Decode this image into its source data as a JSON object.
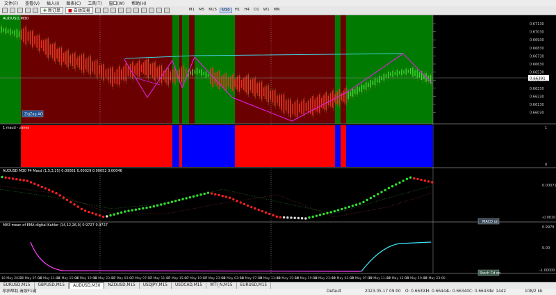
{
  "menu": [
    "文件(F)",
    "查看(V)",
    "插入(I)",
    "图表(C)",
    "工具(T)",
    "窗口(W)",
    "帮助(H)"
  ],
  "toolbar": {
    "new_order": "新订单",
    "autotrade": "自动交易",
    "timeframes": [
      "M1",
      "M5",
      "M15",
      "M30",
      "H1",
      "H4",
      "D1",
      "W1",
      "MN"
    ],
    "active_timeframe": "M30"
  },
  "chart": {
    "symbol_label": "AUDUSD,M30",
    "zigzag_button": "ZigZag AO",
    "price_ticks": [
      "0.67130",
      "0.67030",
      "0.66930",
      "0.66830",
      "0.66730",
      "0.66630",
      "0.66530",
      "0.66430",
      "0.66330",
      "0.66230",
      "0.66130",
      "0.66030"
    ],
    "current_price": "0.66391",
    "sub1_label": "1 macd - zones",
    "sub1_ticks": [
      "1",
      "0"
    ],
    "sub2_label": "AUDUSD M30 P4 Macd (1.5,3,25) 0.00061 0.00029 0.00052 0.00046",
    "sub2_ticks": [
      "0.00071",
      "-0.00103"
    ],
    "sub2_button": "MACD on",
    "sub3_label": "MA3 mean of EMA digital Kahler (14,12,26,9) 0.9727 0.9727",
    "sub3_ticks": [
      "0.9978",
      "0.00",
      "-1.00000"
    ],
    "sub3_button": "Stoch Cd on",
    "time_labels": [
      "16 May 2023",
      "16 May 07:00",
      "16 May 11:00",
      "16 May 15:00",
      "16 May 19:00",
      "16 May 23:00",
      "17 May 03:00",
      "17 May 07:00",
      "17 May 11:00",
      "17 May 15:00",
      "17 May 19:00",
      "17 May 23:00",
      "18 May 03:00",
      "18 May 07:00",
      "18 May 11:00",
      "18 May 15:00",
      "18 May 19:00",
      "18 May 23:00",
      "19 May 03:00",
      "19 May 07:00",
      "19 May 11:00",
      "19 May 15:00",
      "19 May 19:00",
      "19 May 23:00"
    ],
    "colors": {
      "bull_zone": "#007a00",
      "bear_zone": "#6b0000",
      "zone_red": "#ff0000",
      "zone_blue": "#0000ff",
      "zigzag": "#e020e0",
      "trendline": "#40d0e0",
      "bull_bar": "#30e030",
      "bear_bar": "#ff2020",
      "stoch_up": "#40e8ff",
      "stoch_down": "#ff40ff"
    }
  },
  "tabs": [
    "EURUSD,M15",
    "GBPUSD,M15",
    "AUDUSD,M30",
    "NZDUSD,M15",
    "USDJPY,M15",
    "USDCAD,M15",
    "WTI_N,M15",
    "EURUSD,M15"
  ],
  "active_tab": "AUDUSD,M30",
  "status": {
    "help": "寻求帮助,请按F1键",
    "profile": "Default",
    "datetime": "2023.05.17 09:00",
    "open": "O: 0.66391",
    "high": "H: 0.66444",
    "low": "L: 0.66340",
    "close": "C: 0.66434",
    "volume": "V: 1442",
    "traffic": "108/2 kb"
  }
}
